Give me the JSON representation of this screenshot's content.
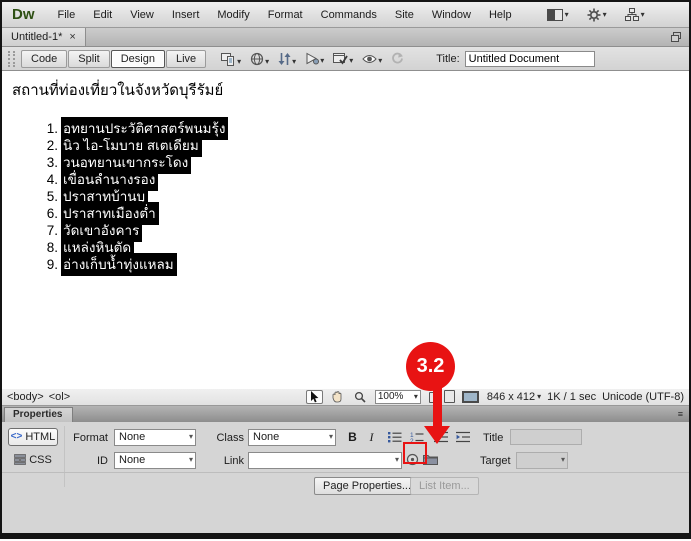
{
  "window": {
    "logo_text": "Dw",
    "menu": [
      "File",
      "Edit",
      "View",
      "Insert",
      "Modify",
      "Format",
      "Commands",
      "Site",
      "Window",
      "Help"
    ],
    "tab_title": "Untitled-1*"
  },
  "toolbar": {
    "views": [
      "Code",
      "Split",
      "Design",
      "Live"
    ],
    "active_view": "Design",
    "title_label": "Title:",
    "title_value": "Untitled Document"
  },
  "document": {
    "heading": "สถานที่ท่องเที่ยวในจังหวัดบุรีรัมย์",
    "list_items": [
      "อุทยานประวัติศาสตร์พนมรุ้ง",
      "นิว ไอ-โมบาย สเตเดียม",
      "วนอุทยานเขากระโดง",
      "เขื่อนลำนางรอง",
      "ปราสาทบ้านบุ",
      "ปราสาทเมืองต่ำ",
      "วัดเขาอังคาร",
      "แหล่งหินตัด",
      "อ่างเก็บน้ำทุ่งแหลม"
    ]
  },
  "status_bar": {
    "tag_body": "<body>",
    "tag_ol": "<ol>",
    "zoom_level": "100%",
    "window_size": "846 x 412",
    "file_info": "1K / 1 sec",
    "encoding": "Unicode (UTF-8)"
  },
  "callout": {
    "label": "3.2",
    "color": "#e81313"
  },
  "properties": {
    "panel_tab": "Properties",
    "html_icon": "<>",
    "html_label": "HTML",
    "css_label": "CSS",
    "format_label": "Format",
    "format_value": "None",
    "id_label": "ID",
    "id_value": "None",
    "class_label": "Class",
    "class_value": "None",
    "link_label": "Link",
    "bold_label": "B",
    "italic_label": "I",
    "title_label": "Title",
    "target_label": "Target",
    "page_properties_label": "Page Properties...",
    "list_item_label": "List Item..."
  },
  "icons": {
    "dropdown": "▾",
    "close": "×",
    "panel_menu": "≡"
  }
}
